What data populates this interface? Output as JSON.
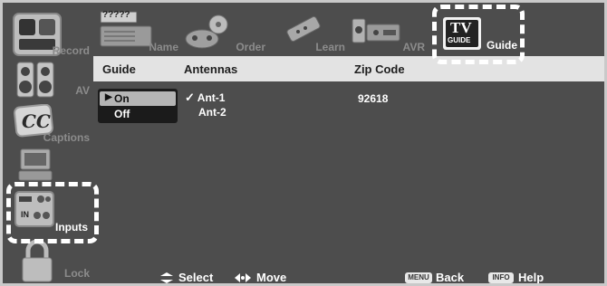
{
  "sidebar": {
    "items": [
      {
        "label": "Record",
        "icon": "record-icon"
      },
      {
        "label": "AV",
        "icon": "speakers-icon"
      },
      {
        "label": "Captions",
        "icon": "cc-icon"
      },
      {
        "label": "",
        "icon": "tv-set-icon"
      },
      {
        "label": "Inputs",
        "icon": "inputs-icon"
      },
      {
        "label": "Lock",
        "icon": "lock-icon"
      }
    ]
  },
  "tabs": [
    {
      "label": "Name",
      "icon": "device-icon",
      "badge": "?????"
    },
    {
      "label": "Order",
      "icon": "gamepad-icon"
    },
    {
      "label": "Learn",
      "icon": "remote-icon"
    },
    {
      "label": "AVR",
      "icon": "receiver-icon"
    },
    {
      "label": "Guide",
      "icon": "tv-guide-icon",
      "logo_top": "TV",
      "logo_bottom": "GUIDE"
    }
  ],
  "table": {
    "headers": {
      "guide": "Guide",
      "antennas": "Antennas",
      "zip": "Zip Code"
    },
    "guide_options": [
      {
        "label": "On",
        "selected": true
      },
      {
        "label": "Off",
        "selected": false
      }
    ],
    "antennas": [
      {
        "label": "Ant-1",
        "checked": true
      },
      {
        "label": "Ant-2",
        "checked": false
      }
    ],
    "zip_code": "92618"
  },
  "footer": {
    "select_label": "Select",
    "move_label": "Move",
    "back_key": "MENU",
    "back_label": "Back",
    "help_key": "INFO",
    "help_label": "Help"
  },
  "symbols": {
    "arrow": "▶",
    "check": "✓"
  },
  "colors": {
    "background": "#4d4d4d",
    "header_bar": "#e3e3e3",
    "selected": "#b5b5b5",
    "highlight": "#ffffff"
  }
}
